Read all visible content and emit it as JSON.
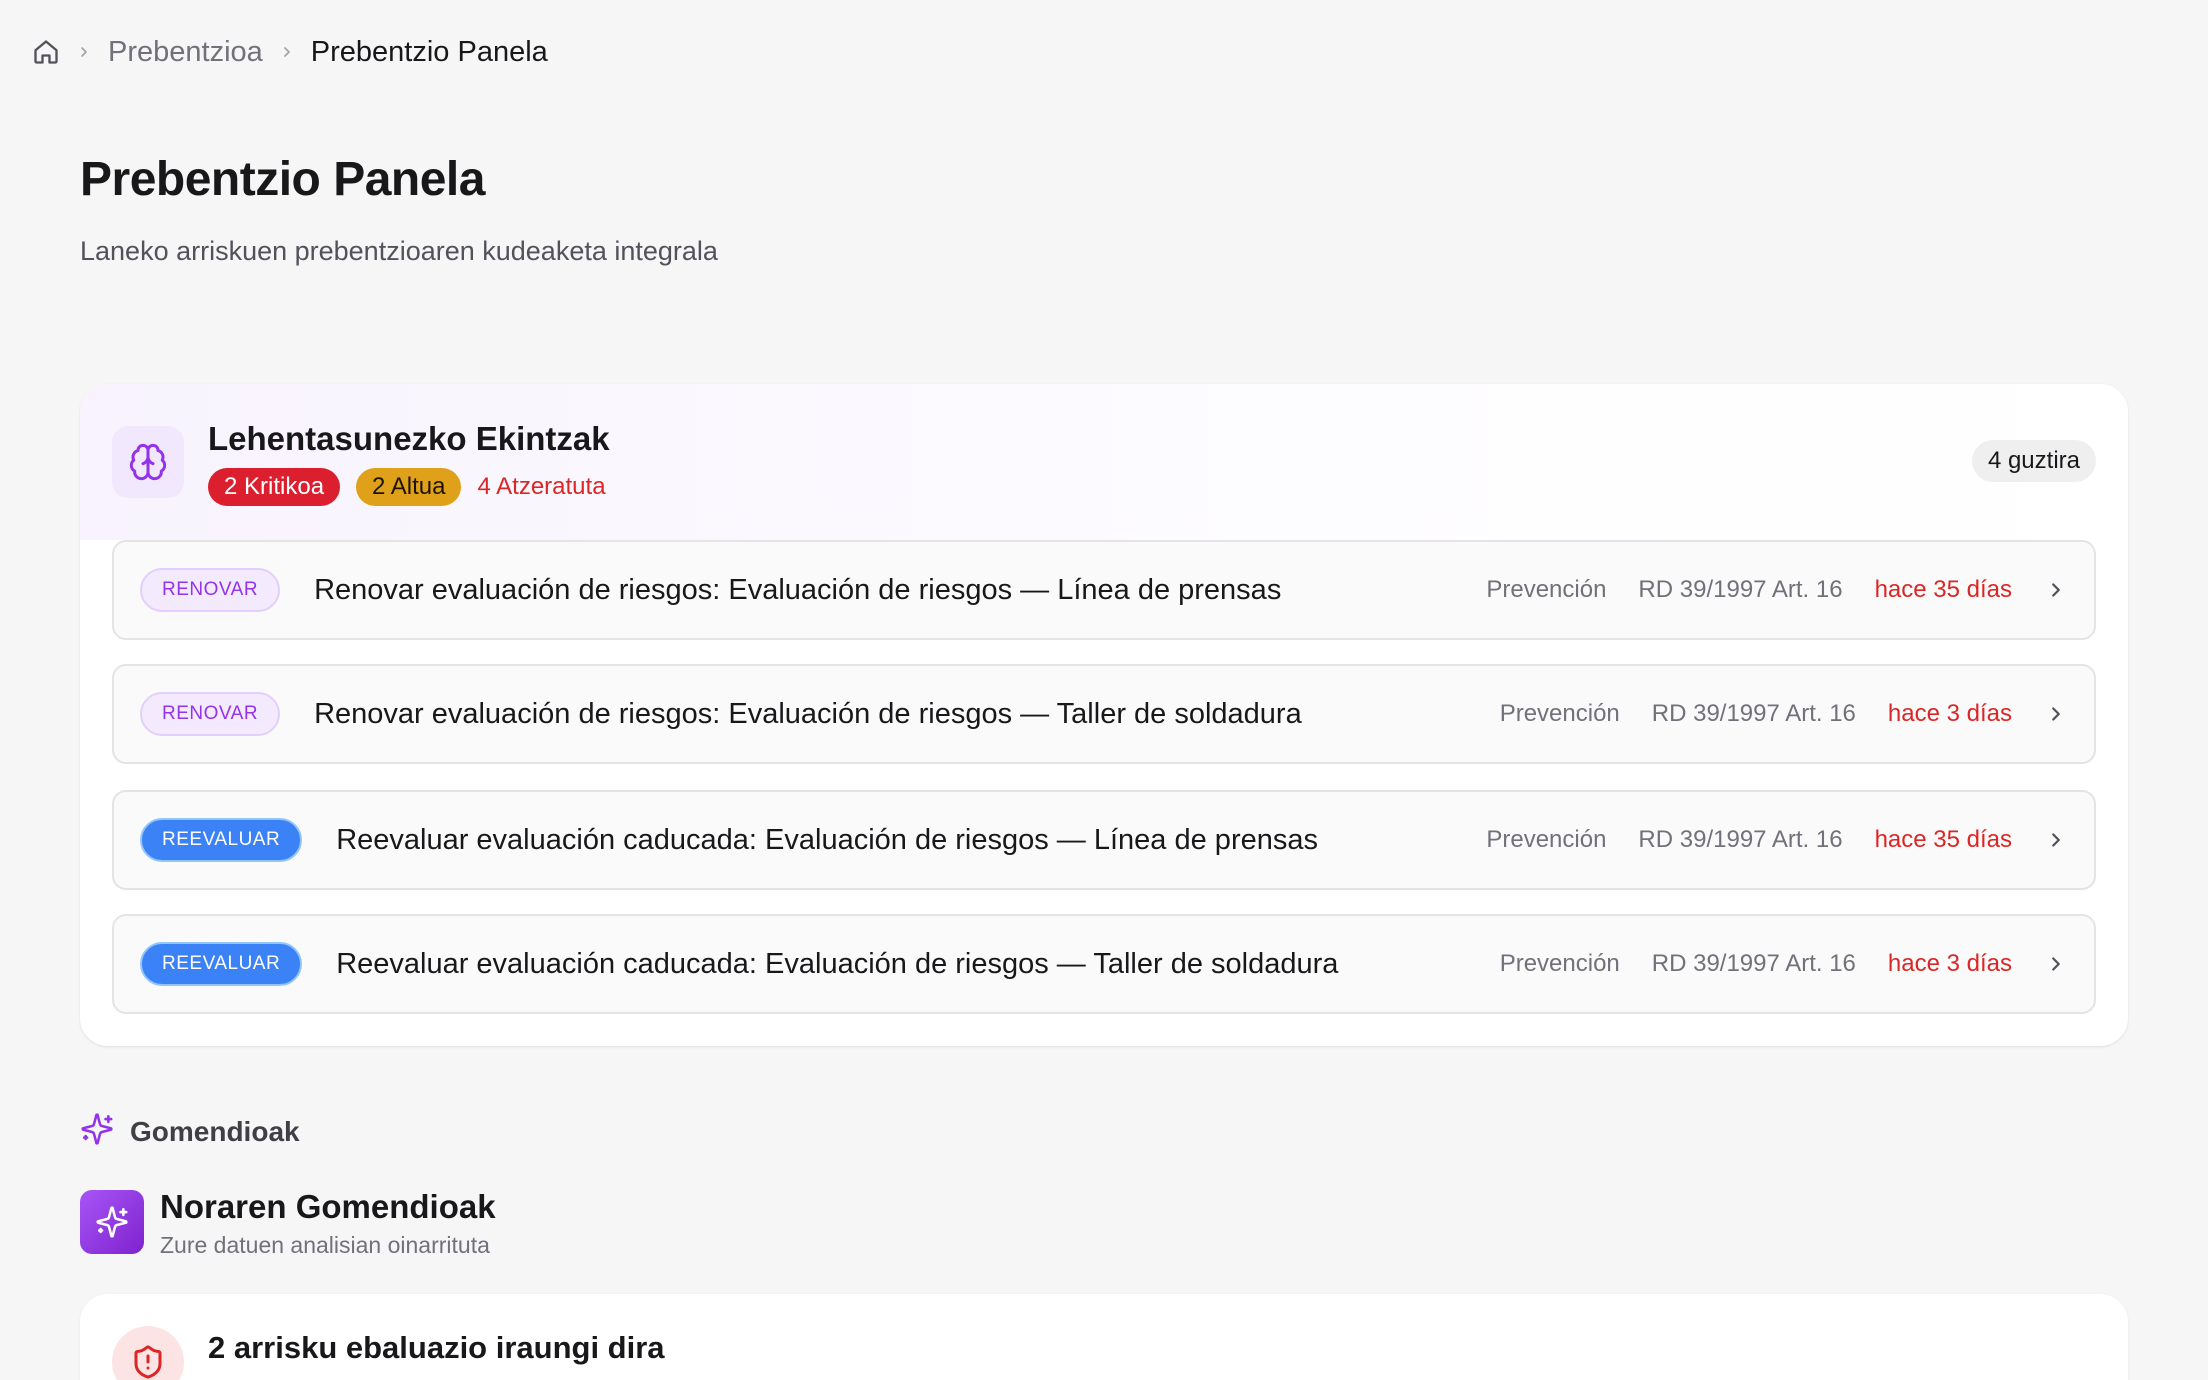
{
  "breadcrumb": {
    "items": [
      "Prebentzioa",
      "Prebentzio Panela"
    ]
  },
  "header": {
    "title": "Prebentzio Panela",
    "subtitle": "Laneko arriskuen prebentzioaren kudeaketa integrala"
  },
  "priority": {
    "title": "Lehentasunezko Ekintzak",
    "critical": "2 Kritikoa",
    "high": "2 Altua",
    "overdue": "4 Atzeratuta",
    "total": "4 guztira",
    "actions": [
      {
        "tag": "RENOVAR",
        "title": "Renovar evaluación de riesgos: Evaluación de riesgos — Línea de prensas",
        "area": "Prevención",
        "ref": "RD 39/1997 Art. 16",
        "age": "hace 35 días"
      },
      {
        "tag": "RENOVAR",
        "title": "Renovar evaluación de riesgos: Evaluación de riesgos — Taller de soldadura",
        "area": "Prevención",
        "ref": "RD 39/1997 Art. 16",
        "age": "hace 3 días"
      },
      {
        "tag": "REEVALUAR",
        "title": "Reevaluar evaluación caducada: Evaluación de riesgos — Línea de prensas",
        "area": "Prevención",
        "ref": "RD 39/1997 Art. 16",
        "age": "hace 35 días"
      },
      {
        "tag": "REEVALUAR",
        "title": "Reevaluar evaluación caducada: Evaluación de riesgos — Taller de soldadura",
        "area": "Prevención",
        "ref": "RD 39/1997 Art. 16",
        "age": "hace 3 días"
      }
    ]
  },
  "recommendations": {
    "section_label": "Gomendioak",
    "title": "Noraren Gomendioak",
    "subtitle": "Zure datuen analisian oinarrituta",
    "items": [
      {
        "title": "2 arrisku ebaluazio iraungi dira"
      }
    ]
  },
  "colors": {
    "accent_purple": "#9333ea",
    "accent_blue": "#3b82f6",
    "critical_red": "#dc1f2e",
    "high_amber": "#e0a11a",
    "overdue_red": "#dc2626"
  },
  "icons": {
    "home": "home-icon",
    "chevron": "chevron-right-icon",
    "brain": "brain-icon",
    "sparkles": "sparkles-icon",
    "shield": "shield-alert-icon"
  }
}
